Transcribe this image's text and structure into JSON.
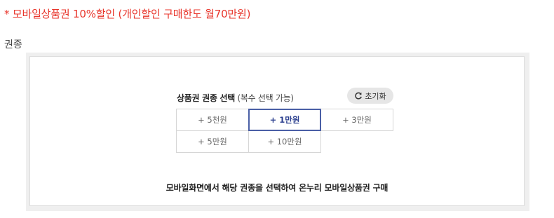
{
  "notice": "* 모바일상품권 10%할인 (개인할인 구매한도 월70만원)",
  "section_label": "권종",
  "selector": {
    "title": "상품권 권종 선택",
    "subtitle": "(복수 선택 가능)",
    "reset_label": "초기화",
    "reset_icon": "refresh-icon",
    "options": [
      {
        "label": "+ 5천원",
        "selected": false
      },
      {
        "label": "+ 1만원",
        "selected": true
      },
      {
        "label": "+ 3만원",
        "selected": false
      },
      {
        "label": "+ 5만원",
        "selected": false
      },
      {
        "label": "+ 10만원",
        "selected": false
      }
    ],
    "footer": "모바일화면에서 해당 권종을 선택하여 온누리 모바일상품권 구매"
  },
  "colors": {
    "notice": "#e8352b",
    "selected_border": "#4a5fa6",
    "selected_text": "#2b3f8f"
  }
}
